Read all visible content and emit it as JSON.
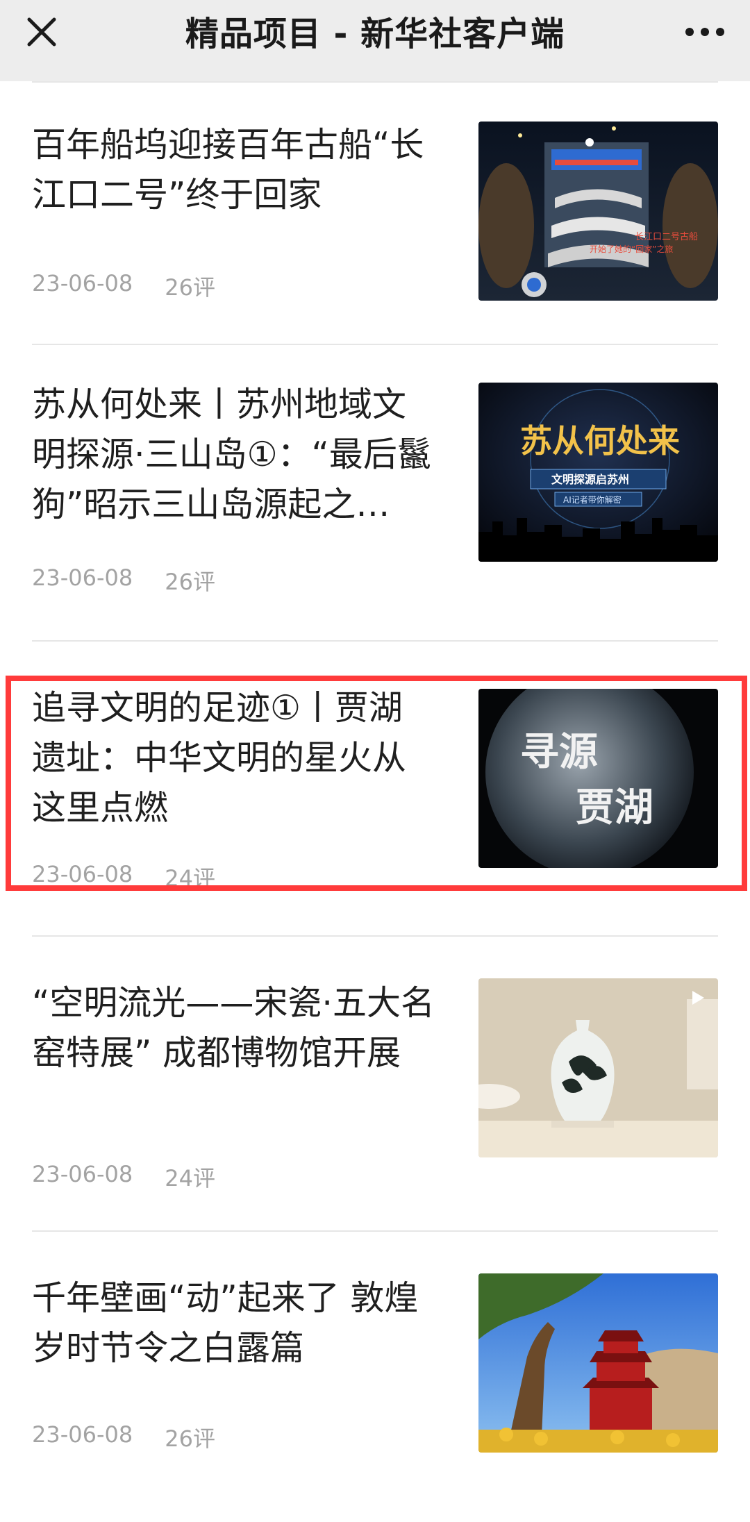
{
  "topbar": {
    "title": "精品项目 - 新华社客户端",
    "close_icon": "close-icon",
    "more_icon": "more-dots-icon"
  },
  "items": [
    {
      "headline": "百年船坞迎接百年古船“长江口二号”终于回家",
      "date": "23-06-08",
      "comments": "26评",
      "thumb_caption": "长江口二号古船\n开始了她的“回家”之旅"
    },
    {
      "headline": "苏从何处来丨苏州地域文明探源·三山岛①：“最后鬣狗”昭示三山岛源起之…",
      "date": "23-06-08",
      "comments": "26评",
      "thumb_title": "苏从何处来",
      "thumb_sub1": "文明探源启苏州",
      "thumb_sub2": "AI记者带你解密"
    },
    {
      "headline": "追寻文明的足迹①丨贾湖遗址：中华文明的星火从这里点燃",
      "date": "23-06-08",
      "comments": "24评",
      "thumb_text1": "寻源",
      "thumb_text2": "贾湖"
    },
    {
      "headline": "“空明流光——宋瓷·五大名窑特展” 成都博物馆开展",
      "date": "23-06-08",
      "comments": "24评"
    },
    {
      "headline": "千年壁画“动”起来了 敦煌岁时节令之白露篇",
      "date": "23-06-08",
      "comments": "26评"
    }
  ],
  "colors": {
    "topbar_bg": "#ededed",
    "highlight": "#ff3b3b",
    "meta_text": "#a3a3a3"
  }
}
